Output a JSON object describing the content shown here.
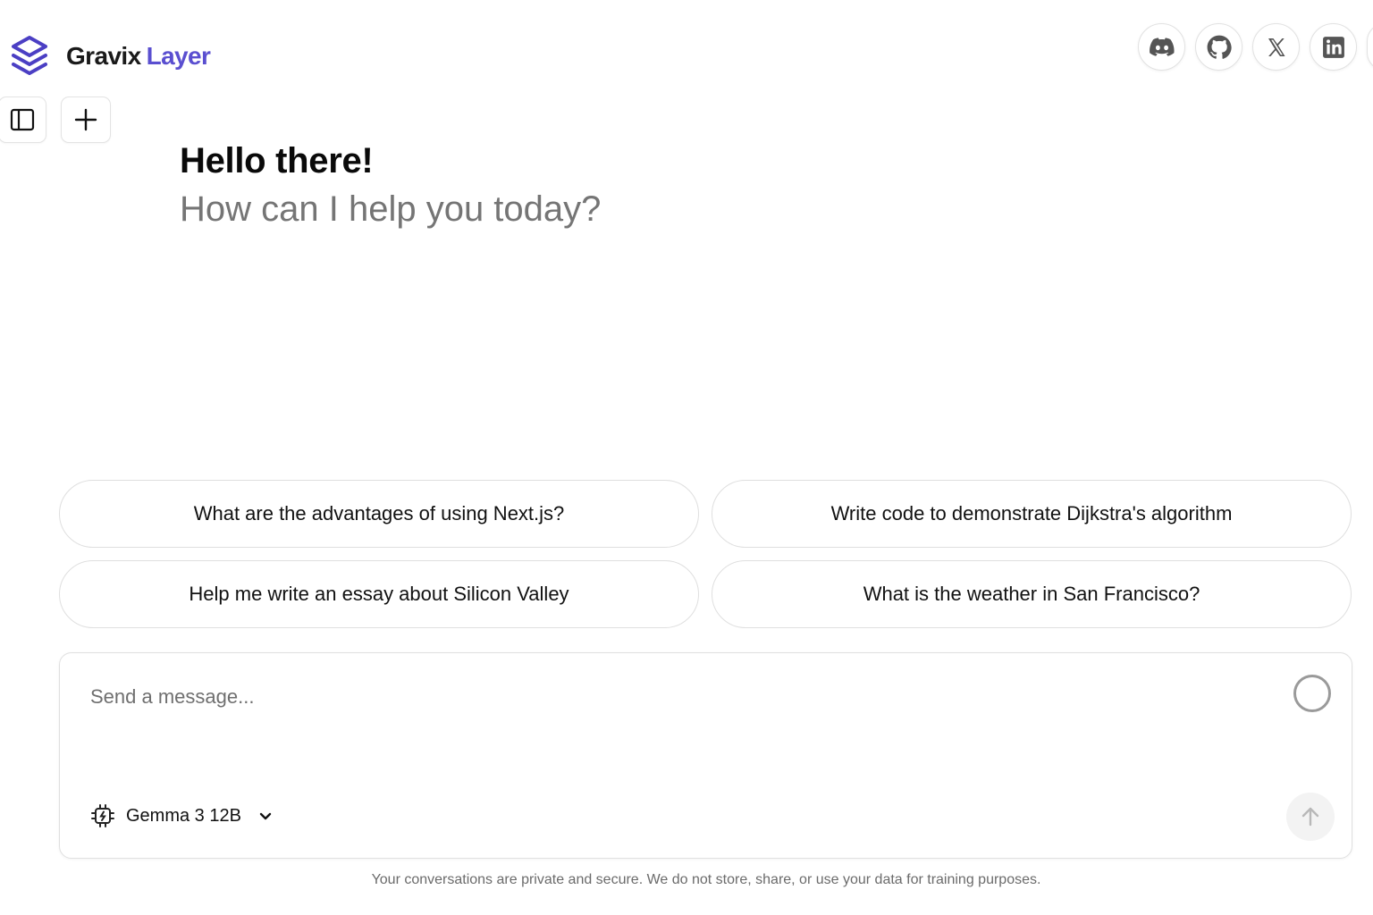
{
  "brand": {
    "name_part1": "Gravix",
    "name_part2": "Layer",
    "accent_color": "#5a4fd0"
  },
  "toolbar": {
    "sidebar_icon": "sidebar-toggle-icon",
    "new_chat_icon": "plus-icon"
  },
  "social": [
    {
      "name": "discord",
      "icon": "discord-icon"
    },
    {
      "name": "github",
      "icon": "github-icon"
    },
    {
      "name": "x",
      "icon": "x-icon"
    },
    {
      "name": "linkedin",
      "icon": "linkedin-icon"
    }
  ],
  "greeting": {
    "title": "Hello there!",
    "subtitle": "How can I help you today?"
  },
  "suggestions": [
    "What are the advantages of using Next.js?",
    "Write code to demonstrate Dijkstra's algorithm",
    "Help me write an essay about Silicon Valley",
    "What is the weather in San Francisco?"
  ],
  "composer": {
    "placeholder": "Send a message...",
    "value": "",
    "model": "Gemma 3 12B",
    "send_icon": "arrow-up-icon",
    "model_icon": "chip-icon"
  },
  "footer": {
    "disclaimer": "Your conversations are private and secure. We do not store, share, or use your data for training purposes."
  }
}
